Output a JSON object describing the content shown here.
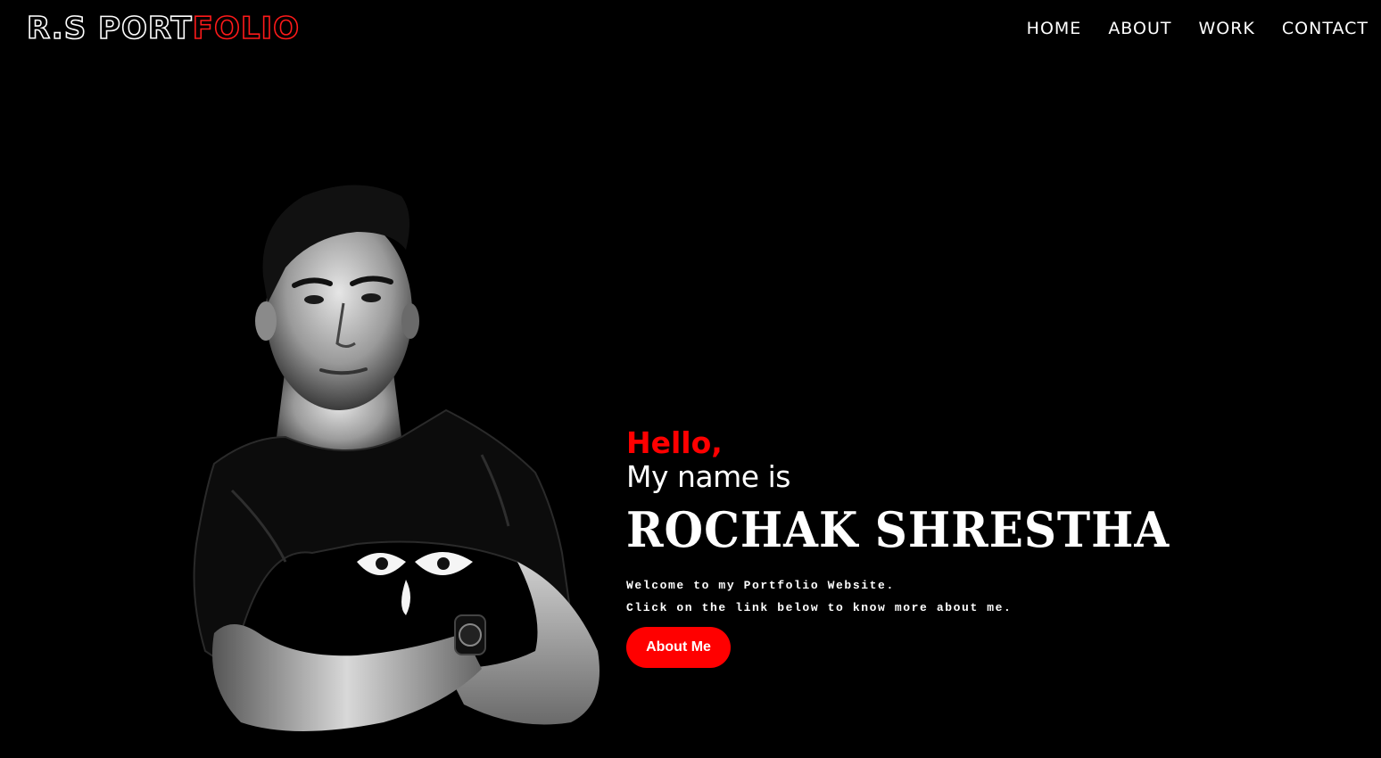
{
  "header": {
    "logo_primary": "R.S PORT",
    "logo_accent": "FOLIO",
    "nav": [
      "HOME",
      "ABOUT",
      "WORK",
      "CONTACT"
    ]
  },
  "hero": {
    "greeting": "Hello,",
    "intro": "My name is",
    "name": "ROCHAK SHRESTHA",
    "line1": "Welcome to my Portfolio Website.",
    "line2": "Click on the link below to know more about me.",
    "button_label": "About Me"
  },
  "colors": {
    "background": "#000000",
    "accent": "#ff0000",
    "text": "#ffffff"
  }
}
